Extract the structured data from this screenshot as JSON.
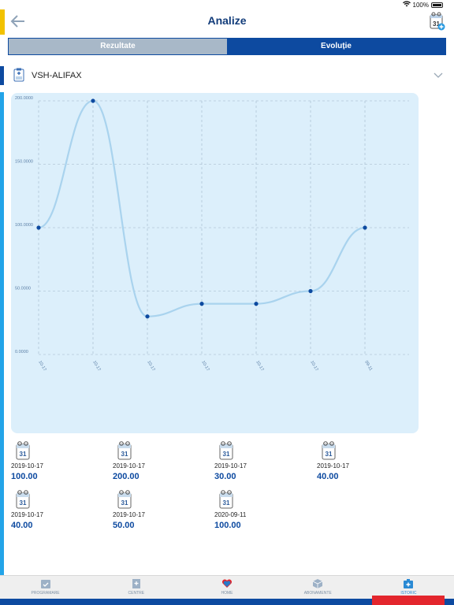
{
  "status": {
    "battery": "100%"
  },
  "header": {
    "title": "Analize"
  },
  "tabs": [
    {
      "label": "Rezultate",
      "active": false
    },
    {
      "label": "Evoluție",
      "active": true
    }
  ],
  "test": {
    "name": "VSH-ALIFAX"
  },
  "chart_data": {
    "type": "line",
    "smooth": true,
    "x": [
      "10-17",
      "10-17",
      "10-17",
      "10-17",
      "10-17",
      "10-17",
      "09-11"
    ],
    "values": [
      100,
      200,
      30,
      40,
      40,
      50,
      100
    ],
    "yticks": [
      "200.0000",
      "150.0000",
      "100.0000",
      "50.0000",
      "0.0000"
    ],
    "ylim": [
      0,
      200
    ],
    "grid": true,
    "colors": {
      "line": "#a9d3ee",
      "point": "#0d4aa0",
      "grid": "#9fb5c8",
      "background": "#dceffb"
    }
  },
  "results": [
    {
      "date": "2019-10-17",
      "value": "100.00"
    },
    {
      "date": "2019-10-17",
      "value": "200.00"
    },
    {
      "date": "2019-10-17",
      "value": "30.00"
    },
    {
      "date": "2019-10-17",
      "value": "40.00"
    },
    {
      "date": "2019-10-17",
      "value": "40.00"
    },
    {
      "date": "2019-10-17",
      "value": "50.00"
    },
    {
      "date": "2020-09-11",
      "value": "100.00"
    }
  ],
  "calendar_icon_day": "31",
  "nav": [
    {
      "label": "PROGRAMARE",
      "icon": "calendar-check-icon",
      "active": false
    },
    {
      "label": "CENTRE",
      "icon": "hospital-icon",
      "active": false
    },
    {
      "label": "HOME",
      "icon": "heart-home-icon",
      "active": false
    },
    {
      "label": "ABONAMENTE",
      "icon": "box-icon",
      "active": false
    },
    {
      "label": "ISTORIC",
      "icon": "medical-kit-icon",
      "active": true
    }
  ],
  "theme": {
    "brand": "#0d4aa0",
    "accent": "#f2c200",
    "strip": "#23a4e8",
    "alert": "#e3262d"
  }
}
